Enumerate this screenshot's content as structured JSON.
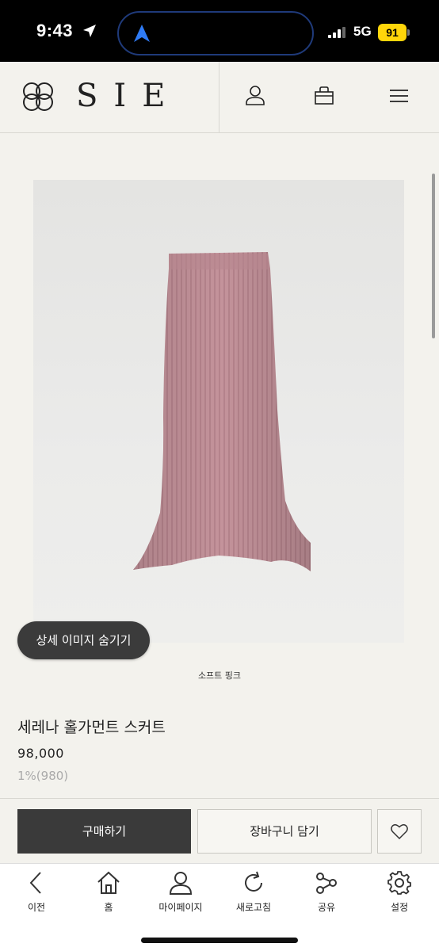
{
  "status_bar": {
    "time": "9:43",
    "network": "5G",
    "battery": "91"
  },
  "header": {
    "logo_text": "SIE",
    "icons": [
      "user-icon",
      "shopping-bag-icon",
      "menu-icon"
    ]
  },
  "product": {
    "hide_images_label": "상세 이미지 숨기기",
    "color_label": "소프트 핑크",
    "name": "세레나 홀가먼트 스커트",
    "price": "98,000",
    "points": "1%(980)"
  },
  "actions": {
    "buy_label": "구매하기",
    "cart_label": "장바구니 담기",
    "wishlist_icon": "heart-icon"
  },
  "bottom_nav": {
    "items": [
      {
        "label": "이전",
        "icon": "back-icon"
      },
      {
        "label": "홈",
        "icon": "home-icon"
      },
      {
        "label": "마이페이지",
        "icon": "person-icon"
      },
      {
        "label": "새로고침",
        "icon": "refresh-icon"
      },
      {
        "label": "공유",
        "icon": "share-icon"
      },
      {
        "label": "설정",
        "icon": "settings-icon"
      }
    ]
  },
  "colors": {
    "background": "#f3f2ed",
    "buy_button": "#3a3a3a",
    "battery": "#ffd60a",
    "skirt": "#c4939b"
  }
}
